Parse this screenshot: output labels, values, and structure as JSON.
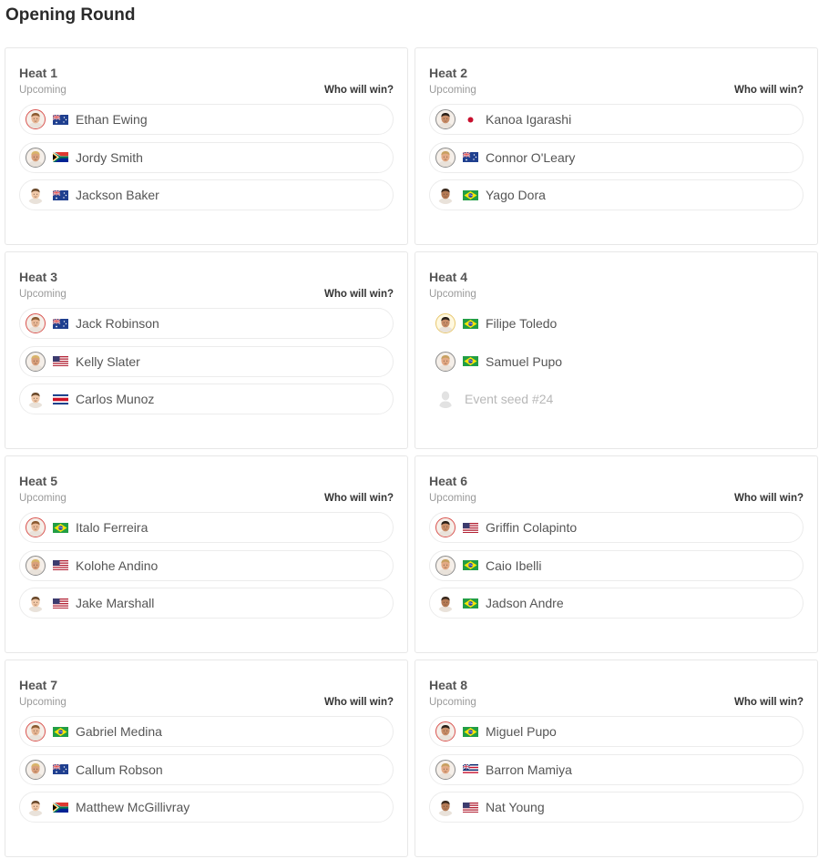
{
  "page": {
    "title": "Opening Round"
  },
  "colors": {
    "card_border": "#e7e7e7",
    "status_text": "#9a9a9a",
    "name_text": "#555555",
    "avatar_red_ring": "#d9534f",
    "avatar_gold_ring": "#e8c870"
  },
  "heats": [
    {
      "title": "Heat 1",
      "status": "Upcoming",
      "predict_label": "Who will win?",
      "surfers": [
        {
          "name": "Ethan Ewing",
          "flag": "australia-flag",
          "ring": "red"
        },
        {
          "name": "Jordy Smith",
          "flag": "south-africa-flag",
          "ring": "gray"
        },
        {
          "name": "Jackson Baker",
          "flag": "australia-flag",
          "ring": "none"
        }
      ]
    },
    {
      "title": "Heat 2",
      "status": "Upcoming",
      "predict_label": "Who will win?",
      "surfers": [
        {
          "name": "Kanoa Igarashi",
          "flag": "japan-flag",
          "ring": "gray"
        },
        {
          "name": "Connor O'Leary",
          "flag": "australia-flag",
          "ring": "gray"
        },
        {
          "name": "Yago Dora",
          "flag": "brazil-flag",
          "ring": "none"
        }
      ]
    },
    {
      "title": "Heat 3",
      "status": "Upcoming",
      "predict_label": "Who will win?",
      "surfers": [
        {
          "name": "Jack Robinson",
          "flag": "australia-flag",
          "ring": "red"
        },
        {
          "name": "Kelly Slater",
          "flag": "usa-flag",
          "ring": "gray"
        },
        {
          "name": "Carlos Munoz",
          "flag": "costa-rica-flag",
          "ring": "none"
        }
      ]
    },
    {
      "title": "Heat 4",
      "status": "Upcoming",
      "predict_label": "",
      "surfers": [
        {
          "name": "Filipe Toledo",
          "flag": "brazil-flag",
          "ring": "gold"
        },
        {
          "name": "Samuel Pupo",
          "flag": "brazil-flag",
          "ring": "gray"
        },
        {
          "name": "Event seed #24",
          "flag": "",
          "ring": "placeholder"
        }
      ]
    },
    {
      "title": "Heat 5",
      "status": "Upcoming",
      "predict_label": "Who will win?",
      "surfers": [
        {
          "name": "Italo Ferreira",
          "flag": "brazil-flag",
          "ring": "red"
        },
        {
          "name": "Kolohe Andino",
          "flag": "usa-flag",
          "ring": "gray"
        },
        {
          "name": "Jake Marshall",
          "flag": "usa-flag",
          "ring": "none"
        }
      ]
    },
    {
      "title": "Heat 6",
      "status": "Upcoming",
      "predict_label": "Who will win?",
      "surfers": [
        {
          "name": "Griffin Colapinto",
          "flag": "usa-flag",
          "ring": "red"
        },
        {
          "name": "Caio Ibelli",
          "flag": "brazil-flag",
          "ring": "gray"
        },
        {
          "name": "Jadson Andre",
          "flag": "brazil-flag",
          "ring": "none"
        }
      ]
    },
    {
      "title": "Heat 7",
      "status": "Upcoming",
      "predict_label": "Who will win?",
      "surfers": [
        {
          "name": "Gabriel Medina",
          "flag": "brazil-flag",
          "ring": "red"
        },
        {
          "name": "Callum Robson",
          "flag": "australia-flag",
          "ring": "gray"
        },
        {
          "name": "Matthew McGillivray",
          "flag": "south-africa-flag",
          "ring": "none"
        }
      ]
    },
    {
      "title": "Heat 8",
      "status": "Upcoming",
      "predict_label": "Who will win?",
      "surfers": [
        {
          "name": "Miguel Pupo",
          "flag": "brazil-flag",
          "ring": "red"
        },
        {
          "name": "Barron Mamiya",
          "flag": "hawaii-flag",
          "ring": "gray"
        },
        {
          "name": "Nat Young",
          "flag": "usa-flag",
          "ring": "none"
        }
      ]
    }
  ]
}
